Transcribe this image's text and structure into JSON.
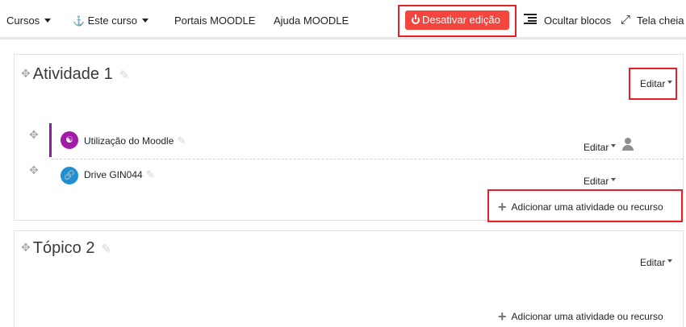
{
  "navbar": {
    "courses": "Cursos",
    "this_course": "Este curso",
    "portals": "Portais MOODLE",
    "help": "Ajuda MOODLE",
    "edit_toggle": "Desativar edição",
    "hide_blocks": "Ocultar blocos",
    "fullscreen": "Tela cheia"
  },
  "sections": [
    {
      "title": "Atividade 1",
      "edit_label": "Editar",
      "activities": [
        {
          "name": "Utilização do Moodle",
          "edit_label": "Editar",
          "icon": "forum-icon",
          "icon_color": "#a01ba7"
        },
        {
          "name": "Drive GIN044",
          "edit_label": "Editar",
          "icon": "url-link-icon",
          "icon_color": "#1f8ed4"
        }
      ],
      "add_label": "Adicionar uma atividade ou recurso"
    },
    {
      "title": "Tópico 2",
      "edit_label": "Editar",
      "add_label": "Adicionar uma atividade ou recurso"
    }
  ],
  "colors": {
    "edit_toggle_bg": "#f4463f",
    "highlight_box": "#e8202a",
    "restricted_bar": "#8a1ea5"
  }
}
